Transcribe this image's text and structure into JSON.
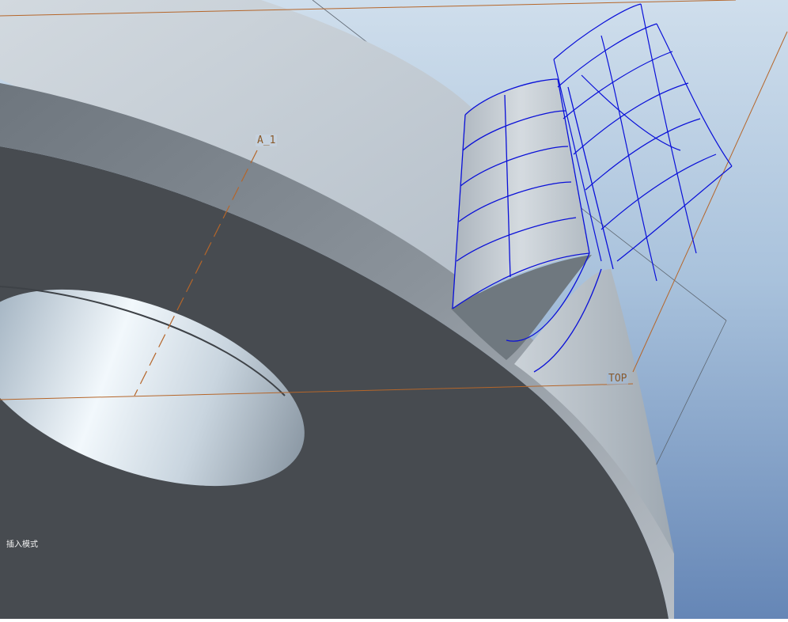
{
  "viewport": {
    "axis_label": "A_1",
    "datum_plane_label": "TOP",
    "mode_status": "插入模式"
  },
  "colors": {
    "background_top": "#c8d8e8",
    "background_bottom": "#6a8ab8",
    "part_face": "#c3cbd3",
    "part_dark": "#474b50",
    "wireframe": "#0a10d8",
    "datum": "#b5662a"
  }
}
